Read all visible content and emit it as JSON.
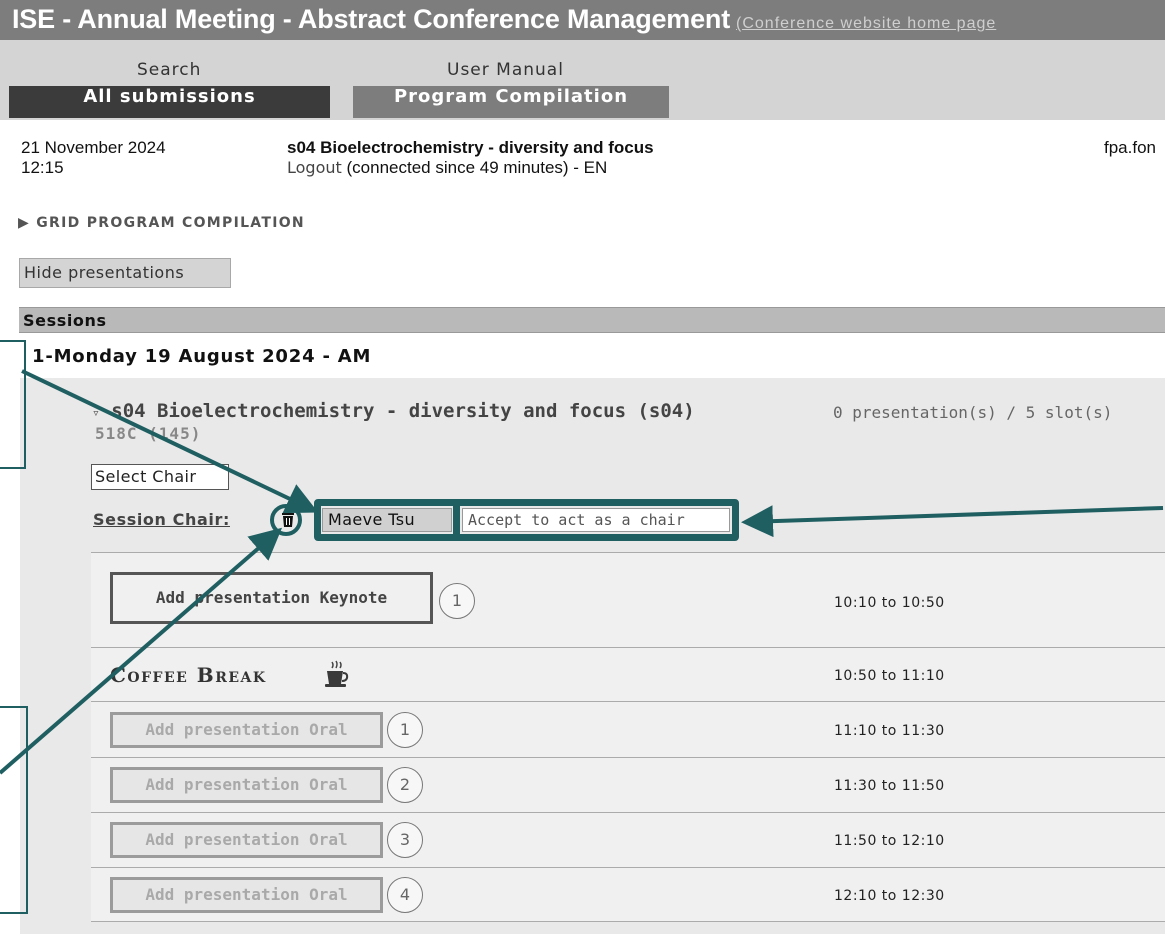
{
  "header": {
    "title": "ISE - Annual Meeting - Abstract Conference Management",
    "home_link": "(Conference website home page",
    "menu": {
      "search": "Search",
      "manual": "User Manual"
    },
    "tabs": {
      "all": "All submissions",
      "program": "Program Compilation"
    }
  },
  "info": {
    "date": "21 November 2024",
    "time": "12:15",
    "session_name": "s04 Bioelectrochemistry - diversity and focus",
    "logout": "Logout",
    "connected": " (connected since 49 minutes) - EN",
    "user": "fpa.fon"
  },
  "grid_toggle": "GRID PROGRAM COMPILATION",
  "hide_button": "Hide presentations",
  "sessions_header": "Sessions",
  "day_heading": "1-Monday 19 August 2024 - AM",
  "session": {
    "title": "s04 Bioelectrochemistry - diversity and focus (s04)",
    "count": "0 presentation(s) / 5 slot(s)",
    "room": "518C (145)",
    "select_chair": "Select Chair",
    "chair_label": "Session Chair:",
    "chair_name": "Maeve Tsu",
    "accept_chair": "Accept to act as a chair"
  },
  "slots": [
    {
      "label": "Add presentation Keynote",
      "num": "1",
      "time": "10:10 to 10:50"
    },
    {
      "label": "Coffee Break",
      "time": "10:50 to 11:10"
    },
    {
      "label": "Add presentation Oral",
      "num": "1",
      "time": "11:10 to 11:30"
    },
    {
      "label": "Add presentation Oral",
      "num": "2",
      "time": "11:30 to 11:50"
    },
    {
      "label": "Add presentation Oral",
      "num": "3",
      "time": "11:50 to 12:10"
    },
    {
      "label": "Add presentation Oral",
      "num": "4",
      "time": "12:10 to 12:30"
    }
  ],
  "icons": {
    "trash": "trash-icon",
    "coffee": "coffee-cup-icon",
    "disclosure": "triangle-right-icon"
  },
  "colors": {
    "annotation": "#1f5f62",
    "header": "#7d7d7d",
    "active_tab": "#3b3b3b"
  }
}
